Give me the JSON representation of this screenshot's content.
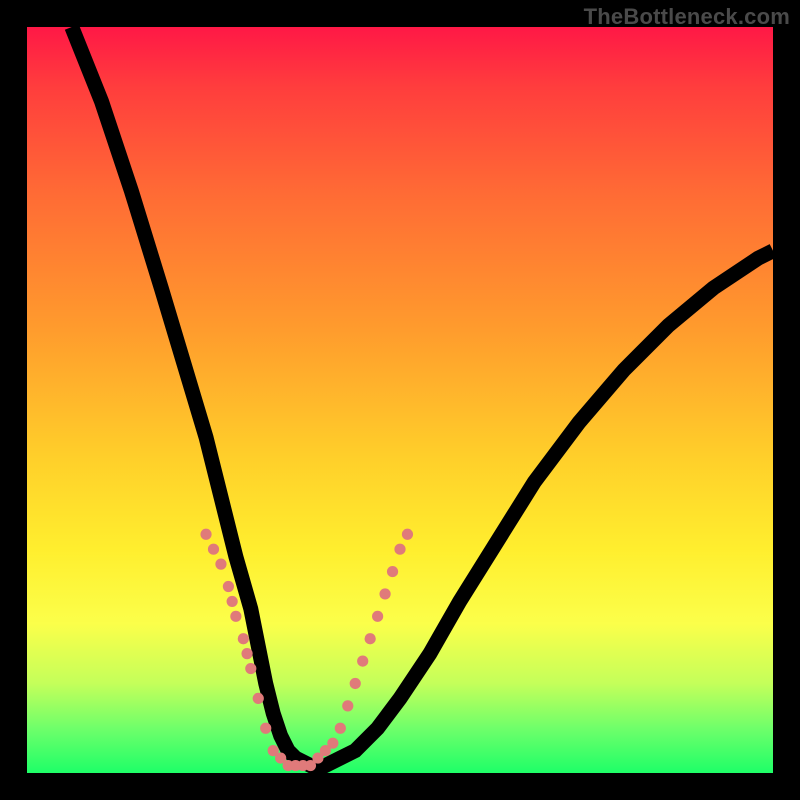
{
  "watermark": "TheBottleneck.com",
  "colors": {
    "gradient_top": "#ff1846",
    "gradient_bottom": "#1eff68",
    "curve": "#000000",
    "dots": "#e07a7a",
    "frame": "#000000"
  },
  "chart_data": {
    "type": "line",
    "title": "",
    "xlabel": "",
    "ylabel": "",
    "xlim": [
      0,
      100
    ],
    "ylim": [
      0,
      100
    ],
    "grid": false,
    "legend": false,
    "series": [
      {
        "name": "bottleneck-curve",
        "x": [
          6,
          10,
          14,
          18,
          21,
          24,
          26,
          28,
          30,
          31,
          32,
          33,
          34,
          35,
          36,
          38,
          40,
          42,
          44,
          47,
          50,
          54,
          58,
          63,
          68,
          74,
          80,
          86,
          92,
          98,
          100
        ],
        "y": [
          100,
          90,
          78,
          65,
          55,
          45,
          37,
          29,
          22,
          17,
          12,
          8,
          5,
          3,
          2,
          1,
          1,
          2,
          3,
          6,
          10,
          16,
          23,
          31,
          39,
          47,
          54,
          60,
          65,
          69,
          70
        ]
      }
    ],
    "points": [
      {
        "x": 24,
        "y": 32
      },
      {
        "x": 25,
        "y": 30
      },
      {
        "x": 26,
        "y": 28
      },
      {
        "x": 27,
        "y": 25
      },
      {
        "x": 27.5,
        "y": 23
      },
      {
        "x": 28,
        "y": 21
      },
      {
        "x": 29,
        "y": 18
      },
      {
        "x": 29.5,
        "y": 16
      },
      {
        "x": 30,
        "y": 14
      },
      {
        "x": 31,
        "y": 10
      },
      {
        "x": 32,
        "y": 6
      },
      {
        "x": 33,
        "y": 3
      },
      {
        "x": 34,
        "y": 2
      },
      {
        "x": 35,
        "y": 1
      },
      {
        "x": 36,
        "y": 1
      },
      {
        "x": 37,
        "y": 1
      },
      {
        "x": 38,
        "y": 1
      },
      {
        "x": 39,
        "y": 2
      },
      {
        "x": 40,
        "y": 3
      },
      {
        "x": 41,
        "y": 4
      },
      {
        "x": 42,
        "y": 6
      },
      {
        "x": 43,
        "y": 9
      },
      {
        "x": 44,
        "y": 12
      },
      {
        "x": 45,
        "y": 15
      },
      {
        "x": 46,
        "y": 18
      },
      {
        "x": 47,
        "y": 21
      },
      {
        "x": 48,
        "y": 24
      },
      {
        "x": 49,
        "y": 27
      },
      {
        "x": 50,
        "y": 30
      },
      {
        "x": 51,
        "y": 32
      }
    ]
  }
}
